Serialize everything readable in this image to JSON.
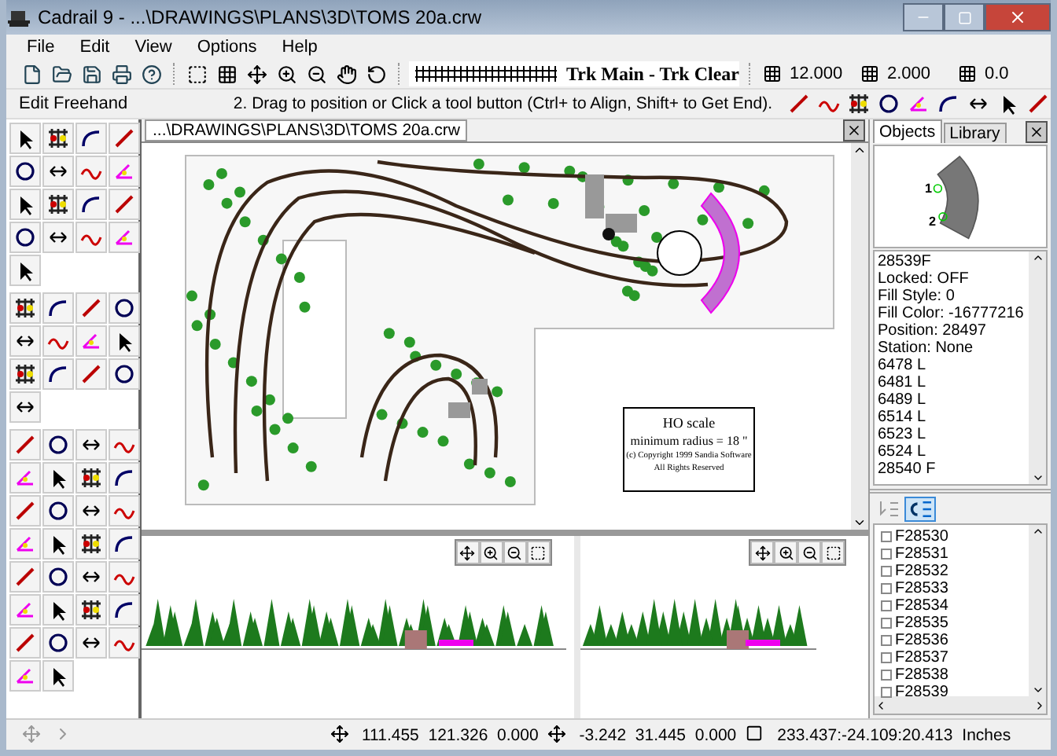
{
  "window": {
    "title": "Cadrail 9 - ...\\DRAWINGS\\PLANS\\3D\\TOMS 20a.crw"
  },
  "menu": [
    "File",
    "Edit",
    "View",
    "Options",
    "Help"
  ],
  "toolbar": {
    "track_type": "Trk Main - Trk Clear",
    "values": [
      "12.000",
      "2.000",
      "0.0"
    ]
  },
  "mode_bar": {
    "mode": "Edit Freehand",
    "hint": "2. Drag to position or Click a tool button (Ctrl+ to Align, Shift+ to Get End)."
  },
  "document": {
    "tab": "...\\DRAWINGS\\PLANS\\3D\\TOMS 20a.crw",
    "legend": {
      "title": "HO scale",
      "radius": "minimum radius = 18 \"",
      "copyright": "(c) Copyright 1999 Sandia Software",
      "rights": "All Rights Reserved"
    }
  },
  "panel": {
    "tabs": [
      {
        "label": "Objects",
        "selected": true
      },
      {
        "label": "Library",
        "selected": false
      }
    ],
    "preview_labels": [
      "1",
      "2"
    ],
    "properties": [
      "28539F",
      "Locked: OFF",
      "Fill Style: 0",
      "Fill Color: -16777216",
      "Position: 28497",
      "Station: None",
      "6478 L",
      "6481 L",
      "6489 L",
      "6514 L",
      "6523 L",
      "6524 L",
      "28540 F"
    ],
    "tree": [
      "F28530",
      "F28531",
      "F28532",
      "F28533",
      "F28534",
      "F28535",
      "F28536",
      "F28537",
      "F28538",
      "F28539"
    ]
  },
  "status_bar": {
    "cursor": "111.455  121.326  0.000",
    "offset": "-3.242  31.445  0.000",
    "position": "233.437:-24.109:20.413",
    "units": "Inches"
  }
}
